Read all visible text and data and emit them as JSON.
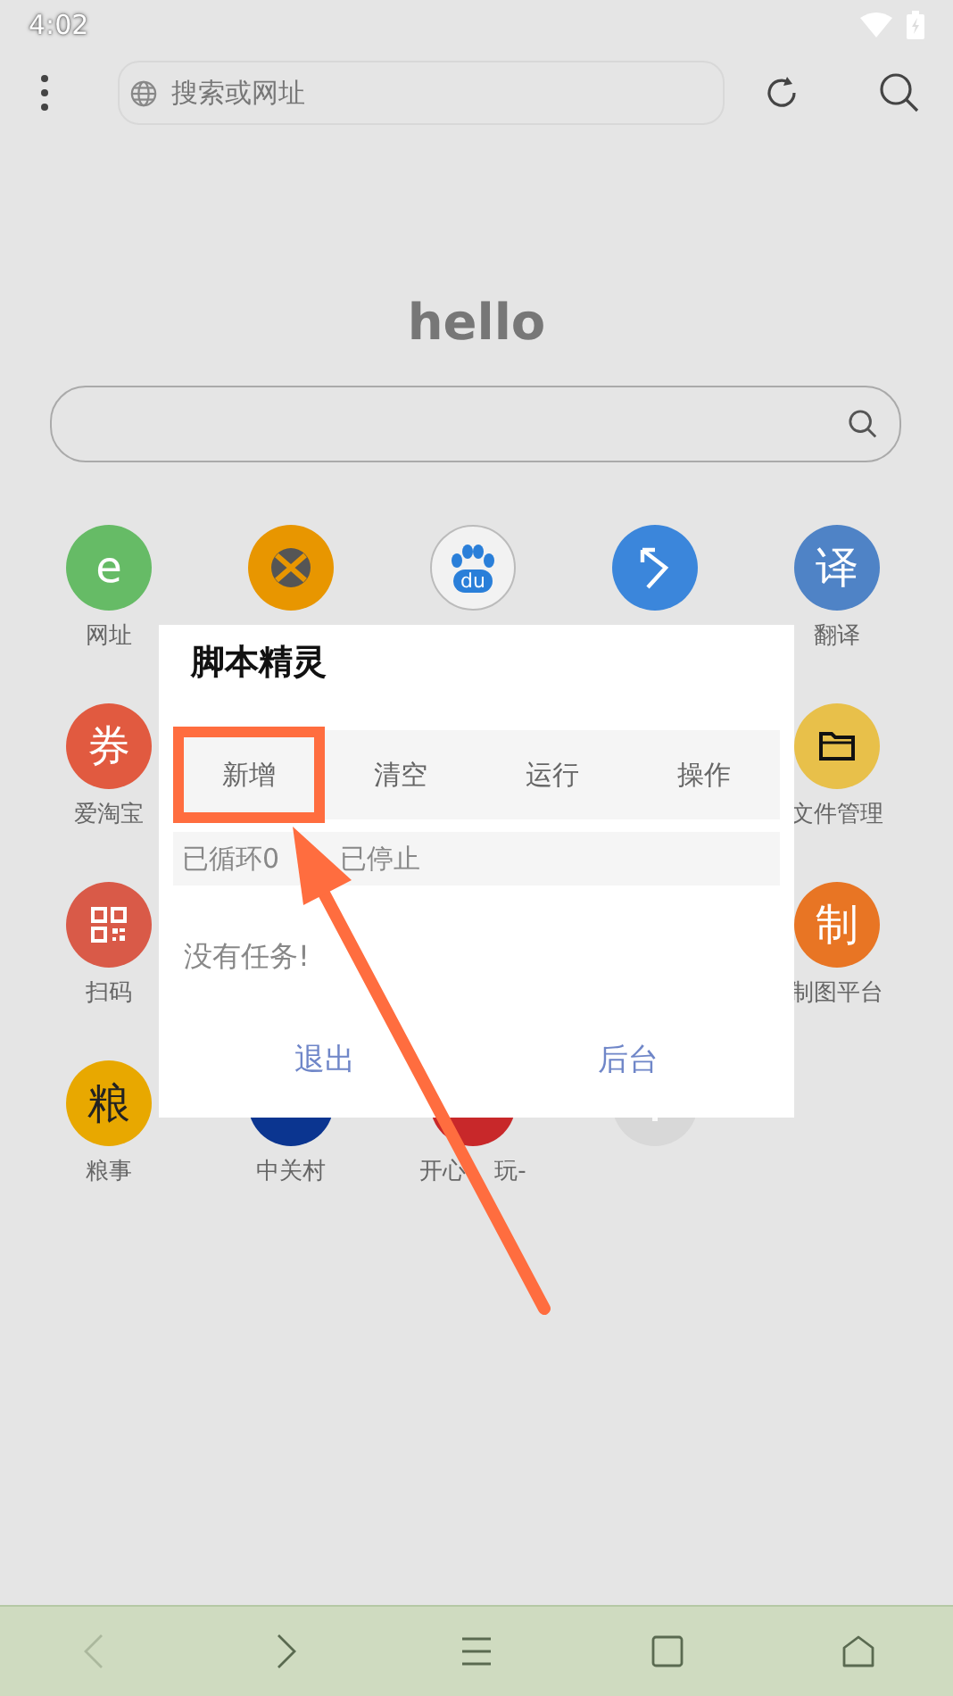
{
  "status_bar": {
    "time": "4:02"
  },
  "toolbar": {
    "search": {
      "placeholder": "搜索或网址"
    }
  },
  "home": {
    "title": "hello"
  },
  "shortcut_rows": [
    {
      "items": [
        {
          "kind": "glyph",
          "glyph": "e",
          "color": "#66bb66",
          "label": "网址"
        },
        {
          "kind": "xbox",
          "color": "#e89600"
        },
        {
          "kind": "paw",
          "glyph": "du",
          "color": "#f2f2f2"
        },
        {
          "kind": "pointer",
          "color": "#3b86db"
        },
        {
          "kind": "glyph",
          "glyph": "译",
          "color": "#4f83c6",
          "label": "翻译"
        }
      ]
    },
    {
      "items": [
        {
          "kind": "glyph",
          "glyph": "券",
          "color": "#e15a40",
          "label": "爱淘宝"
        },
        {
          "kind": "folder",
          "color": "#e8c04a",
          "label": "文件管理"
        }
      ]
    },
    {
      "items": [
        {
          "kind": "qr",
          "color": "#d95a48",
          "label": "扫码"
        },
        {
          "kind": "glyph",
          "glyph": "制",
          "color": "#e87524",
          "label": "制图平台"
        }
      ]
    },
    {
      "items": [
        {
          "kind": "glyph",
          "glyph": "粮",
          "color": "#e8a800",
          "label": "粮事",
          "dark": true
        },
        {
          "kind": "plain",
          "color": "#0b3590",
          "label": "中关村"
        },
        {
          "kind": "plain",
          "color": "#c8282a",
          "label": "开心",
          "label_tail": "玩-"
        },
        {
          "kind": "plus",
          "color": "#d8d8d8"
        }
      ]
    }
  ],
  "dialog": {
    "title": "脚本精灵",
    "tabs": [
      {
        "label": "新增",
        "highlighted": true
      },
      {
        "label": "清空",
        "highlighted": false
      },
      {
        "label": "运行",
        "highlighted": false
      },
      {
        "label": "操作",
        "highlighted": false
      }
    ],
    "status": [
      "已循环0",
      "已停止"
    ],
    "message": "没有任务!",
    "buttons": [
      "退出",
      "后台"
    ]
  },
  "nav": [
    {
      "kind": "back",
      "disabled": true
    },
    {
      "kind": "forward",
      "disabled": false
    },
    {
      "kind": "menu",
      "disabled": false
    },
    {
      "kind": "tabs",
      "disabled": false
    },
    {
      "kind": "home",
      "disabled": false
    }
  ]
}
